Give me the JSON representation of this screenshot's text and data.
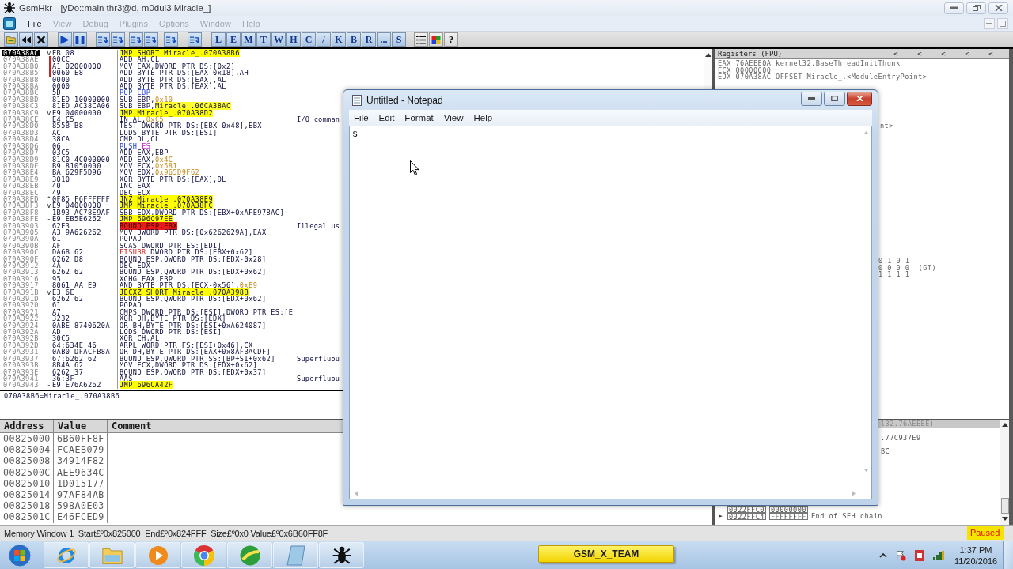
{
  "window": {
    "title": "GsmHkr - [yDo::main thr3@d, m0dul3 Miracle_]"
  },
  "menu": [
    {
      "label": "File",
      "disabled": false
    },
    {
      "label": "View",
      "disabled": true
    },
    {
      "label": "Debug",
      "disabled": true
    },
    {
      "label": "Plugins",
      "disabled": true
    },
    {
      "label": "Options",
      "disabled": true
    },
    {
      "label": "Window",
      "disabled": true
    },
    {
      "label": "Help",
      "disabled": true
    }
  ],
  "toolbar": {
    "letter_buttons": [
      "L",
      "E",
      "M",
      "T",
      "W",
      "H",
      "C",
      "/",
      "K",
      "B",
      "R",
      "...",
      "S"
    ],
    "help_button": "?"
  },
  "disassembly": {
    "rows": [
      {
        "address": "070A38AC",
        "selected": true,
        "jump_mark": "v",
        "hex": "EB 08",
        "disasm": [
          {
            "text": "JMP SHORT Miracle_.070A38B6",
            "kind": "jump"
          }
        ]
      },
      {
        "address": "070A38AE",
        "selected": false,
        "hex": "00CC",
        "disasm": "ADD AH,CL"
      },
      {
        "address": "070A38B0",
        "selected": false,
        "hex": "A1 02000000",
        "disasm": "MOV EAX,DWORD PTR DS:[0x2]"
      },
      {
        "address": "070A38B5",
        "selected": false,
        "hex": "0060 E8",
        "disasm": "ADD BYTE PTR DS:[EAX-0x18],AH"
      },
      {
        "address": "070A38B8",
        "selected": false,
        "hex": "0000",
        "disasm": "ADD BYTE PTR DS:[EAX],AL"
      },
      {
        "address": "070A38BA",
        "selected": false,
        "hex": "0000",
        "disasm": "ADD BYTE PTR DS:[EAX],AL"
      },
      {
        "address": "070A38BC",
        "selected": false,
        "hex": "5D",
        "disasm": [
          {
            "text": "POP EBP",
            "kind": "stack"
          }
        ]
      },
      {
        "address": "070A38BD",
        "selected": false,
        "hex": "81ED 10000000",
        "disasm": [
          {
            "text": "SUB EBP,"
          },
          {
            "text": "0x10",
            "kind": "const"
          }
        ]
      },
      {
        "address": "070A38C3",
        "selected": false,
        "hex": "81ED AC38CA06",
        "disasm": [
          {
            "text": "SUB EBP,"
          },
          {
            "text": "Miracle_.06CA38AC",
            "kind": "label"
          }
        ]
      },
      {
        "address": "070A38C9",
        "selected": false,
        "jump_mark": "v",
        "hex": "E9 04000000",
        "disasm": [
          {
            "text": "JMP Miracle_.070A38D2",
            "kind": "jump"
          }
        ]
      },
      {
        "address": "070A38CE",
        "selected": false,
        "hex": "E4 C5",
        "disasm": [
          {
            "text": "IN AL,"
          },
          {
            "text": "0xC5",
            "kind": "const"
          }
        ],
        "comment": "I/O comman"
      },
      {
        "address": "070A38D0",
        "selected": false,
        "hex": "855B B8",
        "disasm": "TEST DWORD PTR DS:[EBX-0x48],EBX"
      },
      {
        "address": "070A38D3",
        "selected": false,
        "hex": "AC",
        "disasm": "LODS BYTE PTR DS:[ESI]"
      },
      {
        "address": "070A38D4",
        "selected": false,
        "hex": "38CA",
        "disasm": "CMP DL,CL"
      },
      {
        "address": "070A38D6",
        "selected": false,
        "hex": "06",
        "disasm": [
          {
            "text": "PUSH ",
            "kind": "stack"
          },
          {
            "text": "ES",
            "kind": "segment"
          }
        ]
      },
      {
        "address": "070A38D7",
        "selected": false,
        "hex": "03C5",
        "disasm": "ADD EAX,EBP"
      },
      {
        "address": "070A38D9",
        "selected": false,
        "hex": "81C0 4C000000",
        "disasm": [
          {
            "text": "ADD EAX,"
          },
          {
            "text": "0x4C",
            "kind": "const"
          }
        ]
      },
      {
        "address": "070A38DF",
        "selected": false,
        "hex": "B9 81050000",
        "disasm": [
          {
            "text": "MOV ECX,"
          },
          {
            "text": "0x581",
            "kind": "const"
          }
        ]
      },
      {
        "address": "070A38E4",
        "selected": false,
        "hex": "BA 629F5D96",
        "disasm": [
          {
            "text": "MOV EDX,"
          },
          {
            "text": "0x965D9F62",
            "kind": "const"
          }
        ]
      },
      {
        "address": "070A38E9",
        "selected": false,
        "hex": "3010",
        "disasm": "XOR BYTE PTR DS:[EAX],DL"
      },
      {
        "address": "070A38EB",
        "selected": false,
        "hex": "40",
        "disasm": "INC EAX"
      },
      {
        "address": "070A38EC",
        "selected": false,
        "hex": "49",
        "disasm": "DEC ECX"
      },
      {
        "address": "070A38ED",
        "selected": false,
        "jump_mark": "^",
        "hex": "0F85 F6FFFFFF",
        "disasm": [
          {
            "text": "JNZ Miracle_.070A38E9",
            "kind": "jump"
          }
        ]
      },
      {
        "address": "070A38F3",
        "selected": false,
        "jump_mark": "v",
        "hex": "E9 04000000",
        "disasm": [
          {
            "text": "JMP Miracle_.070A38FC",
            "kind": "jump"
          }
        ]
      },
      {
        "address": "070A38F8",
        "selected": false,
        "hex": "1B93 AC78E9AF",
        "disasm": "SBB EDX,DWORD PTR DS:[EBX+0xAFE978AC]"
      },
      {
        "address": "070A38FE",
        "selected": false,
        "jump_mark": "-",
        "hex": "E9 EB5E6262",
        "disasm": [
          {
            "text": "JMP 696C97EE",
            "kind": "jump"
          }
        ]
      },
      {
        "address": "070A3903",
        "selected": false,
        "hex": "62E3",
        "disasm": [
          {
            "text": "BOUND ESP,EBX",
            "kind": "bad"
          }
        ],
        "comment": "Illegal us"
      },
      {
        "address": "070A3905",
        "selected": false,
        "hex": "A3 9A626262",
        "disasm": "MOV DWORD PTR DS:[0x6262629A],EAX"
      },
      {
        "address": "070A390A",
        "selected": false,
        "hex": "61",
        "disasm": "POPAD"
      },
      {
        "address": "070A390B",
        "selected": false,
        "hex": "AF",
        "disasm": "SCAS DWORD PTR ES:[EDI]"
      },
      {
        "address": "070A390C",
        "selected": false,
        "hex": "DA6B 62",
        "disasm": [
          {
            "text": "FISUBR",
            "kind": "fpu"
          },
          {
            "text": " DWORD PTR DS:[EBX+0x62]"
          }
        ]
      },
      {
        "address": "070A390F",
        "selected": false,
        "hex": "6262 D8",
        "disasm": "BOUND ESP,QWORD PTR DS:[EDX-0x28]"
      },
      {
        "address": "070A3912",
        "selected": false,
        "hex": "4A",
        "disasm": "DEC EDX"
      },
      {
        "address": "070A3913",
        "selected": false,
        "hex": "6262 62",
        "disasm": "BOUND ESP,QWORD PTR DS:[EDX+0x62]"
      },
      {
        "address": "070A3916",
        "selected": false,
        "hex": "95",
        "disasm": "XCHG EAX,EBP"
      },
      {
        "address": "070A3917",
        "selected": false,
        "hex": "8061 AA E9",
        "disasm": [
          {
            "text": "AND BYTE PTR DS:[ECX-0x56],"
          },
          {
            "text": "0xE9",
            "kind": "const"
          }
        ]
      },
      {
        "address": "070A391B",
        "selected": false,
        "jump_mark": "v",
        "hex": "E3 6E",
        "disasm": [
          {
            "text": "JECXZ SHORT Miracle_.070A398B",
            "kind": "jump"
          }
        ]
      },
      {
        "address": "070A391D",
        "selected": false,
        "hex": "6262 62",
        "disasm": "BOUND ESP,QWORD PTR DS:[EDX+0x62]"
      },
      {
        "address": "070A3920",
        "selected": false,
        "hex": "61",
        "disasm": "POPAD"
      },
      {
        "address": "070A3921",
        "selected": false,
        "hex": "A7",
        "disasm": "CMPS DWORD PTR DS:[ESI],DWORD PTR ES:[E"
      },
      {
        "address": "070A3922",
        "selected": false,
        "hex": "3232",
        "disasm": "XOR DH,BYTE PTR DS:[EDX]"
      },
      {
        "address": "070A3924",
        "selected": false,
        "hex": "0ABE 8740620A",
        "disasm": "OR BH,BYTE PTR DS:[ESI+0xA624087]"
      },
      {
        "address": "070A392A",
        "selected": false,
        "hex": "AD",
        "disasm": "LODS DWORD PTR DS:[ESI]"
      },
      {
        "address": "070A392B",
        "selected": false,
        "hex": "30C5",
        "disasm": "XOR CH,AL"
      },
      {
        "address": "070A392D",
        "selected": false,
        "hex": "64:634E 46",
        "disasm": "ARPL WORD PTR FS:[ESI+0x46],CX"
      },
      {
        "address": "070A3931",
        "selected": false,
        "hex": "0AB0 DFACFB8A",
        "disasm": "OR DH,BYTE PTR DS:[EAX+0x8AFBACDF]"
      },
      {
        "address": "070A3937",
        "selected": false,
        "hex": "67:6262 62",
        "disasm": "BOUND ESP,QWORD PTR SS:[BP+SI+0x62]",
        "comment": "Superfluou"
      },
      {
        "address": "070A393B",
        "selected": false,
        "hex": "8B4A 62",
        "disasm": "MOV ECX,DWORD PTR DS:[EDX+0x62]"
      },
      {
        "address": "070A393E",
        "selected": false,
        "hex": "6262 37",
        "disasm": "BOUND ESP,QWORD PTR DS:[EDX+0x37]"
      },
      {
        "address": "070A3941",
        "selected": false,
        "hex": "36:3F",
        "disasm": "AAS",
        "comment": "Superfluou"
      },
      {
        "address": "070A3943",
        "selected": false,
        "jump_mark": "-",
        "hex": "E9 E76A6262",
        "disasm": [
          {
            "text": "JMP 696CA42F",
            "kind": "jump"
          }
        ]
      }
    ]
  },
  "info_line": "070A38B6=Miracle_.070A38B6",
  "memory": {
    "columns": [
      "Address",
      "Value",
      "Comment"
    ],
    "rows": [
      {
        "address": "00825000",
        "value": "6B60FF8F"
      },
      {
        "address": "00825004",
        "value": "FCAEB079"
      },
      {
        "address": "00825008",
        "value": "34914F82"
      },
      {
        "address": "0082500C",
        "value": "AEE9634C"
      },
      {
        "address": "00825010",
        "value": "1D015177"
      },
      {
        "address": "00825014",
        "value": "97AF84AB"
      },
      {
        "address": "00825018",
        "value": "598A0E03"
      },
      {
        "address": "0082501C",
        "value": "E46FCED9"
      }
    ]
  },
  "registers": {
    "title": "Registers (FPU)",
    "nav_buttons": [
      "<",
      "<",
      "<",
      "<",
      "<"
    ],
    "lines": [
      {
        "name": "EAX",
        "value": "76AEEE0A",
        "comment": "kernel32.BaseThreadInitThunk"
      },
      {
        "name": "ECX",
        "value": "00000000"
      },
      {
        "name": "EDX",
        "value": "070A38AC",
        "comment": "OFFSET Miracle_.<ModuleEntryPoint>"
      }
    ],
    "eip_fragment": "nt>",
    "fpu_flags": [
      "0 1 0 1",
      "0 0 0 0  (GT)",
      "1 1 1 1"
    ]
  },
  "stack": {
    "top_fragment": "l32.76AEEEE)",
    "fragments": [
      ".77C937E9",
      "BC"
    ],
    "rows": [
      {
        "address": "0022FFC0",
        "value": "00000000"
      },
      {
        "marker": "►",
        "address": "0022FFC4",
        "value": "FFFFFFFF",
        "comment": "End of SEH chain"
      }
    ]
  },
  "status_bar": {
    "text": "Memory Window 1  Start£º0x825000  End£º0x824FFF  Size£º0x0 Value£º0x6B60FF8F",
    "state": "Paused"
  },
  "notepad": {
    "title": "Untitled - Notepad",
    "menu": [
      "File",
      "Edit",
      "Format",
      "View",
      "Help"
    ],
    "value": "s"
  },
  "taskbar": {
    "label": "GSM_X_TEAM",
    "time": "1:37 PM",
    "date": "11/20/2016"
  }
}
